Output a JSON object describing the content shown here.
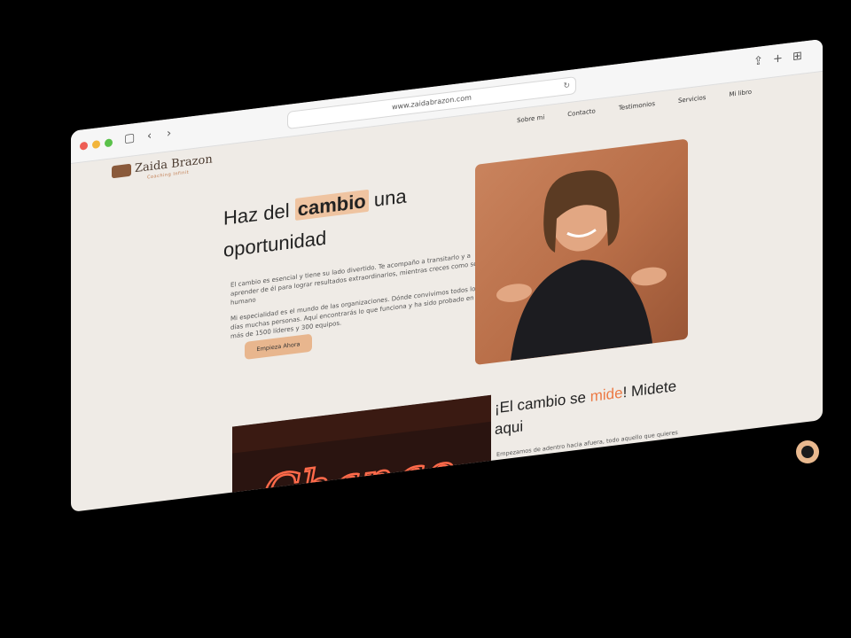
{
  "browser": {
    "url": "www.zaidabrazon.com",
    "back": "‹",
    "forward": "›",
    "reload": "↻",
    "share": "⇪",
    "add_tab": "+",
    "tabs": "⊞"
  },
  "site": {
    "logo_name": "Zaida Brazon",
    "logo_sub": "Coaching Infinit",
    "nav": [
      "Sobre mi",
      "Contacto",
      "Testimonios",
      "Servicios",
      "Mi libro"
    ]
  },
  "hero": {
    "title_pre": "Haz del ",
    "title_hl": "cambio",
    "title_post": " una oportunidad",
    "p1": "El cambio es esencial y tiene su lado divertido. Te acompaño a transitarlo y a aprender de él para lograr resultados extraordinarios, mientras creces como ser humano",
    "p2": "Mi especialidad es el mundo de las organizaciones. Dónde convivimos todos los días muchas personas. Aquí encontrarás lo que funciona y ha sido probado en más de 1500 líderes y 300 equipos.",
    "cta": "Empieza Ahora"
  },
  "section2": {
    "pre": "¡El cambio se ",
    "accent": "mide",
    "post": "! Midete aqui",
    "desc": "Empezamos de adentro hacia afuera, todo aquello que quieres mejorar, necesita medirse antes.",
    "neon": "Change"
  },
  "colors": {
    "accent": "#ec7a45",
    "highlight": "#efc4a1",
    "button": "#e8b68e",
    "background": "#efebe6"
  },
  "icons": {
    "whatsapp": "whatsapp-icon"
  }
}
